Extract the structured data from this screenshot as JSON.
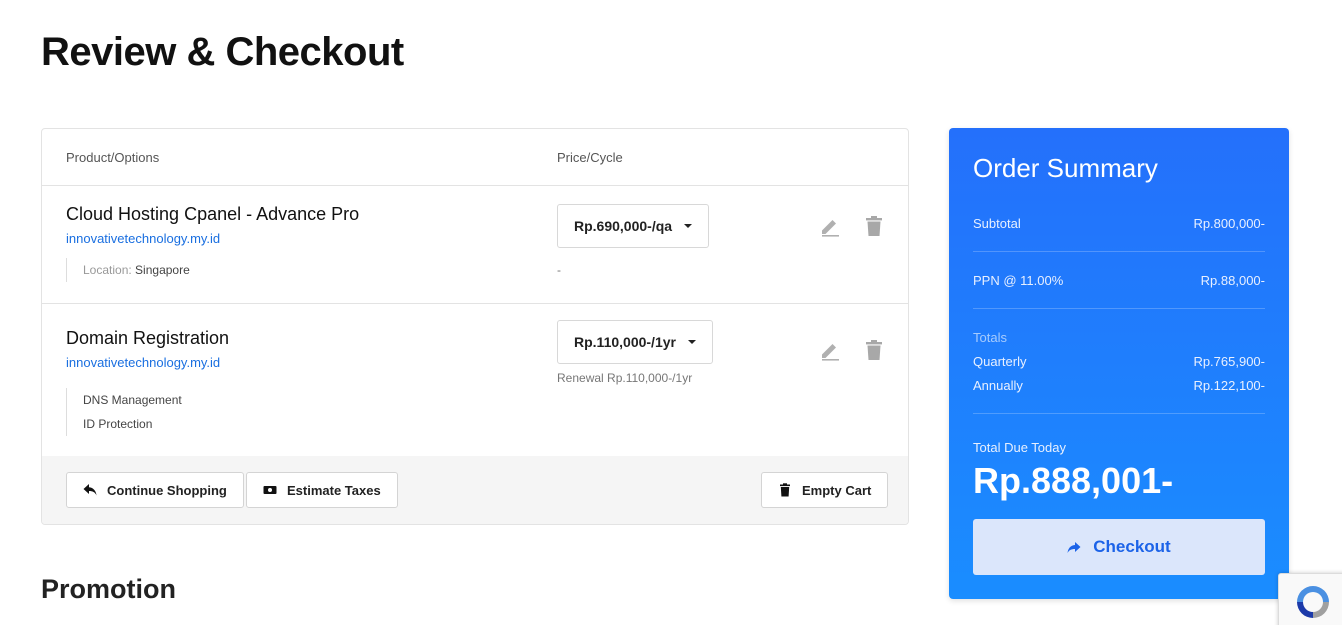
{
  "page": {
    "title": "Review & Checkout"
  },
  "cart": {
    "columns": {
      "product": "Product/Options",
      "price": "Price/Cycle"
    },
    "items": [
      {
        "name": "Cloud Hosting Cpanel - Advance Pro",
        "domain": "innovativetechnology.my.id",
        "location_label": "Location:",
        "location_value": "Singapore",
        "price": "Rp.690,000-/qa",
        "note": "-"
      },
      {
        "name": "Domain Registration",
        "domain": "innovativetechnology.my.id",
        "options": [
          "DNS Management",
          "ID Protection"
        ],
        "price": "Rp.110,000-/1yr",
        "note": "Renewal Rp.110,000-/1yr"
      }
    ],
    "actions": {
      "continue_shopping": "Continue Shopping",
      "estimate_taxes": "Estimate Taxes",
      "empty_cart": "Empty Cart"
    }
  },
  "promotion": {
    "title": "Promotion"
  },
  "summary": {
    "title": "Order Summary",
    "subtotal_label": "Subtotal",
    "subtotal_value": "Rp.800,000-",
    "tax_label": "PPN @ 11.00%",
    "tax_value": "Rp.88,000-",
    "totals_label": "Totals",
    "quarterly_label": "Quarterly",
    "quarterly_value": "Rp.765,900-",
    "annually_label": "Annually",
    "annually_value": "Rp.122,100-",
    "total_due_label": "Total Due Today",
    "total_due_value": "Rp.888,001-",
    "checkout_label": "Checkout"
  },
  "colors": {
    "accent": "#1f7bfc",
    "link": "#1a6fe0",
    "checkout_button_bg": "#dbe6fb",
    "checkout_button_text": "#1c63e8"
  },
  "icons": [
    "pencil-icon",
    "trash-icon",
    "reply-arrow-icon",
    "money-icon",
    "trash-icon",
    "arrow-right-icon",
    "recaptcha-icon"
  ]
}
